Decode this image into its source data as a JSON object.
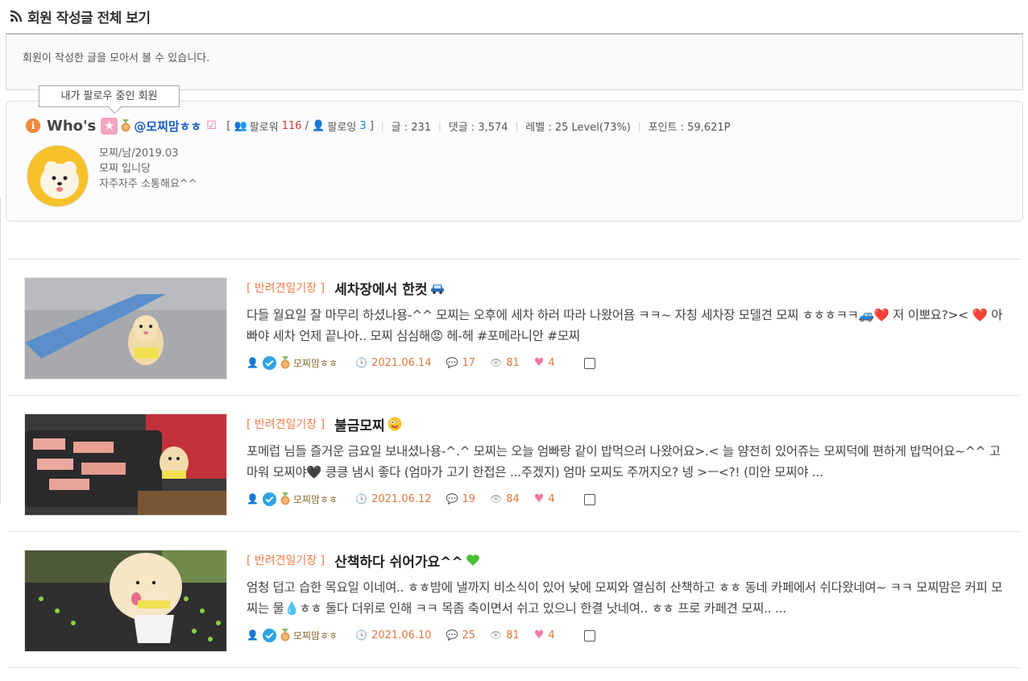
{
  "header": {
    "title": "회원 작성글 전체 보기"
  },
  "description": "회원이 작성한 글을 모아서 볼 수 있습니다.",
  "tooltip": "내가 팔로우 중인 회원",
  "profile": {
    "whos": "Who's",
    "nickname": "@모찌맘ㅎㅎ",
    "follower_label": "팔로워",
    "follower_count": "116",
    "following_label": "팔로잉",
    "following_count": "3",
    "posts": "글 : 231",
    "comments": "댓글 : 3,574",
    "level": "레벨 : 25 Level(73%)",
    "points": "포인트 : 59,621P",
    "info_line1": "모찌/남/2019.03",
    "info_line2": "모찌 입니당",
    "info_line3": "자주자주 소통해요^^"
  },
  "posts": [
    {
      "category": "[ 반려견일기장 ]",
      "title": "세차장에서 한컷",
      "title_emoji": "car",
      "text": "다들 월요일 잘 마무리 하셨나용-^^ 모찌는 오후에 세차 하러 따라 나왔어욤 ㅋㅋ~ 자칭 세차장 모델견 모찌 ㅎㅎㅎㅋㅋ🚙❤️ 저 이뽀요?>< ❤️ 아빠야 세차 언제 끝나아.. 모찌 심심해😡 헤-헤 #포메라니안 #모찌",
      "author": "모찌맘ㅎㅎ",
      "date": "2021.06.14",
      "comments": "17",
      "views": "81",
      "likes": "4"
    },
    {
      "category": "[ 반려견일기장 ]",
      "title": "불금모찌",
      "title_emoji": "crazy-face",
      "text": "포메럽 님들 즐거운 금요일 보내셨나용-^.^ 모찌는 오늘 엄빠랑 같이 밥먹으러 나왔어요>.< 늘 얌전히 있어쥬는 모찌덕에 편하게 밥먹어요~^^ 고마워 모찌야🖤 킁킁 냄시 좋다 (엄마가 고기 한접은 ...주겠지) 엄마 모찌도 주꺼지오? 넹 >ㅡ<?! (미안 모찌야 ...",
      "author": "모찌맘ㅎㅎ",
      "date": "2021.06.12",
      "comments": "19",
      "views": "84",
      "likes": "4"
    },
    {
      "category": "[ 반려견일기장 ]",
      "title": "산책하다 쉬어가요^^",
      "title_emoji": "green-heart",
      "text": "엄청 덥고 습한 목요일 이네여.. ㅎㅎ밤에 낼까지 비소식이 있어 낮에 모찌와 열심히 산책하고 ㅎㅎ 동네 카페에서 쉬다왔네여~ ㅋㅋ 모찌맘은 커피 모찌는 물💧ㅎㅎ 둘다 더위로 인해 ㅋㅋ 목좀 축이면서 쉬고 있으니 한결 낫네여.. ㅎㅎ 프로 카페견 모찌.. ...",
      "author": "모찌맘ㅎㅎ",
      "date": "2021.06.10",
      "comments": "25",
      "views": "81",
      "likes": "4"
    }
  ],
  "colors": {
    "accent": "#ef7b4b",
    "link": "#1a5cc8",
    "heart": "#f07aa5"
  }
}
